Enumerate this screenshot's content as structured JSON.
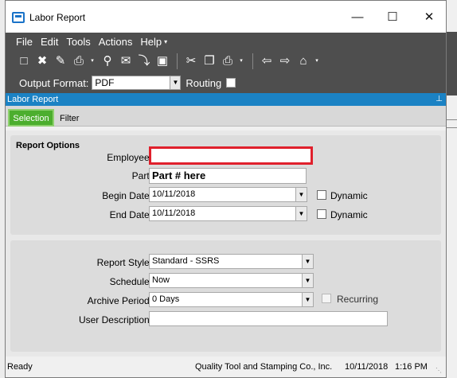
{
  "window": {
    "title": "Labor Report",
    "minimize_glyph": "—",
    "maximize_glyph": "☐",
    "close_glyph": "✕"
  },
  "menu": {
    "items": [
      "File",
      "Edit",
      "Tools",
      "Actions",
      "Help"
    ],
    "overflow": "▾"
  },
  "toolbar": {
    "icons": [
      "new-icon",
      "delete-icon",
      "clear-icon",
      "print-icon",
      "print-preview-icon",
      "email-icon",
      "attach-icon",
      "report-icon",
      "cut-icon",
      "copy-icon",
      "paste-icon",
      "back-icon",
      "forward-icon",
      "home-icon"
    ]
  },
  "output": {
    "label": "Output Format:",
    "value": "PDF",
    "routing_label": "Routing",
    "routing_checked": false
  },
  "panel": {
    "title": "Labor Report",
    "pin_glyph": "⊥"
  },
  "tabs": {
    "selection": "Selection",
    "filter": "Filter"
  },
  "report_options": {
    "title": "Report Options",
    "employee_label": "Employee:",
    "employee_value": "",
    "part_label": "Part:",
    "part_value": "Part # here",
    "begin_date_label": "Begin Date:",
    "begin_date_value": "10/11/2018",
    "end_date_label": "End Date:",
    "end_date_value": "10/11/2018",
    "dynamic_label": "Dynamic"
  },
  "report_settings": {
    "style_label": "Report Style:",
    "style_value": "Standard - SSRS",
    "schedule_label": "Schedule:",
    "schedule_value": "Now",
    "archive_label": "Archive Period:",
    "archive_value": "0 Days",
    "recurring_label": "Recurring",
    "description_label": "User Description:",
    "description_value": ""
  },
  "status": {
    "state": "Ready",
    "company": "Quality Tool and Stamping Co., Inc.",
    "date": "10/11/2018",
    "time": "1:16 PM"
  },
  "colors": {
    "accent_blue": "#1b82c4",
    "tab_green": "#4cae2e",
    "highlight_red": "#e0202c",
    "chrome_dark": "#4e4e4e"
  }
}
